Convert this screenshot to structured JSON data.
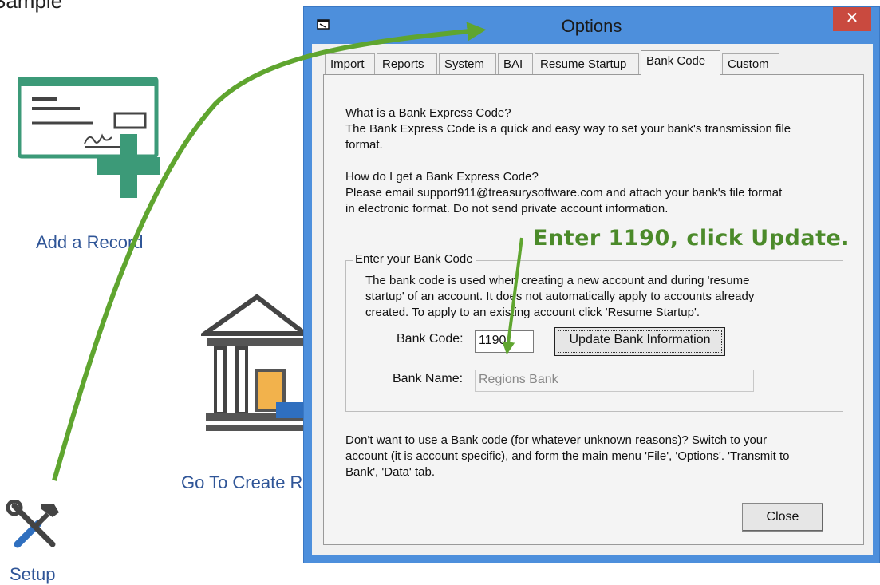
{
  "background": {
    "title": "Sample",
    "add_record_label": "Add a Record",
    "go_create_label": "Go To Create R",
    "setup_label": "Setup"
  },
  "dialog": {
    "title": "Options",
    "close_glyph": "✕",
    "tabs": [
      "Import",
      "Reports",
      "System",
      "BAI",
      "Resume Startup",
      "Bank Code",
      "Custom"
    ],
    "active_tab": "Bank Code",
    "faq": [
      "What is a Bank Express Code?",
      "The Bank Express Code is a quick and easy way to set your bank's transmission file",
      "format.",
      "How do I get a Bank Express Code?",
      "Please email support911@treasurysoftware.com and attach your bank's file format",
      "in electronic format. Do not send private account information."
    ],
    "group": {
      "legend": "Enter your Bank Code",
      "desc": [
        "The bank code is used when creating a new account and during 'resume",
        "startup' of an account.  It does not automatically apply to accounts already",
        "created.  To apply to an existing account click 'Resume Startup'."
      ],
      "bank_code_label": "Bank Code:",
      "bank_code_value": "1190",
      "update_button": "Update Bank Information",
      "bank_name_label": "Bank Name:",
      "bank_name_value": "Regions Bank"
    },
    "footer": [
      "Don't want to use a Bank code (for whatever unknown reasons)?  Switch to your",
      "account (it is account specific), and form the main menu 'File', 'Options'. 'Transmit to",
      "Bank', 'Data' tab."
    ],
    "close_button": "Close"
  },
  "annotation": {
    "text": "Enter 1190, click Update.",
    "color": "#4b8a2a"
  },
  "colors": {
    "dialog_frame": "#4d8fdc",
    "close_red": "#c94a3f",
    "link_blue": "#2f5597",
    "arrow_green": "#5fa52f"
  }
}
